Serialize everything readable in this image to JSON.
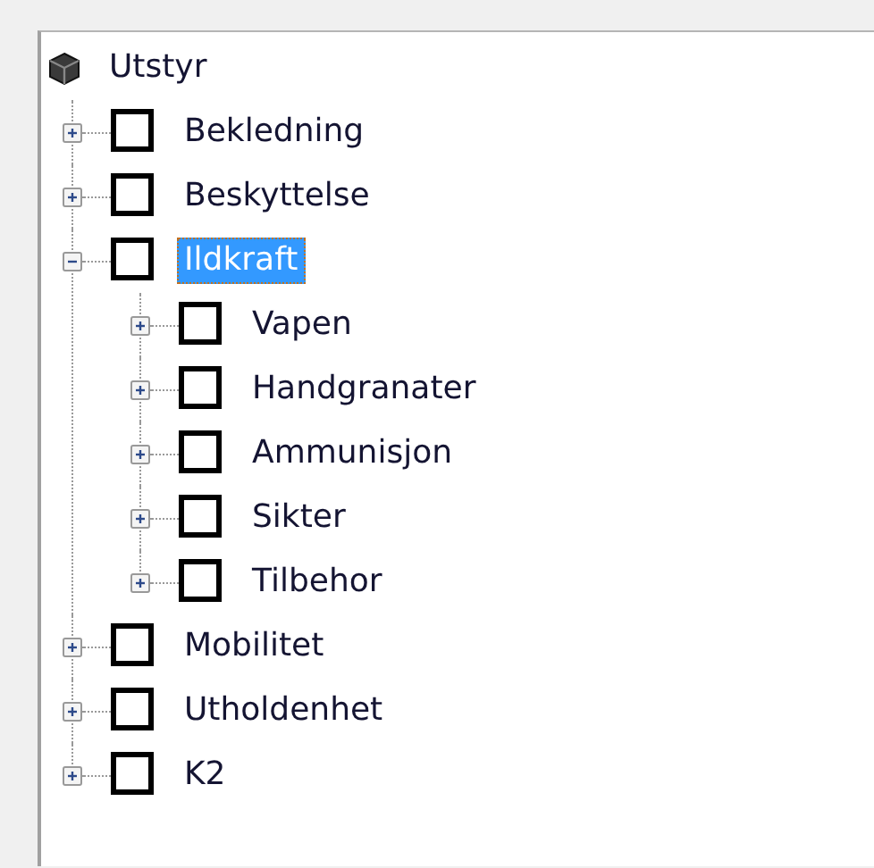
{
  "tree": {
    "label": "Utstyr",
    "children": [
      {
        "label": "Bekledning",
        "expanded": false,
        "checked": false,
        "selected": false
      },
      {
        "label": "Beskyttelse",
        "expanded": false,
        "checked": false,
        "selected": false
      },
      {
        "label": "Ildkraft",
        "expanded": true,
        "checked": false,
        "selected": true,
        "children": [
          {
            "label": "Vapen",
            "expanded": false,
            "checked": false,
            "selected": false
          },
          {
            "label": "Handgranater",
            "expanded": false,
            "checked": false,
            "selected": false
          },
          {
            "label": "Ammunisjon",
            "expanded": false,
            "checked": false,
            "selected": false
          },
          {
            "label": "Sikter",
            "expanded": false,
            "checked": false,
            "selected": false
          },
          {
            "label": "Tilbehor",
            "expanded": false,
            "checked": false,
            "selected": false
          }
        ]
      },
      {
        "label": "Mobilitet",
        "expanded": false,
        "checked": false,
        "selected": false
      },
      {
        "label": "Utholdenhet",
        "expanded": false,
        "checked": false,
        "selected": false
      },
      {
        "label": "K2",
        "expanded": false,
        "checked": false,
        "selected": false
      }
    ]
  }
}
